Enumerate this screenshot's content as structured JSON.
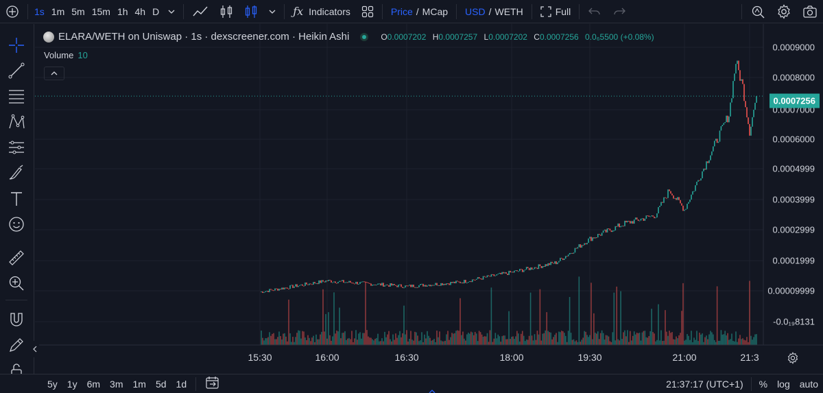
{
  "toolbar": {
    "intervals": [
      "1s",
      "1m",
      "5m",
      "15m",
      "1h",
      "4h",
      "D"
    ],
    "indicators_label": "Indicators",
    "price_label": "Price",
    "mcap_label": "MCap",
    "currency_usd": "USD",
    "currency_weth": "WETH",
    "separator": "/",
    "fullscreen_label": "Full"
  },
  "legend": {
    "title": "ELARA/WETH on Uniswap · 1s · dexscreener.com · Heikin Ashi",
    "open_key": "O",
    "open": "0.0007202",
    "high_key": "H",
    "high": "0.0007257",
    "low_key": "L",
    "low": "0.0007202",
    "close_key": "C",
    "close": "0.0007256",
    "change": "0.0₆5500 (+0.08%)",
    "volume_label": "Volume",
    "volume_value": "10"
  },
  "price_axis": {
    "ticks": [
      "0.0009000",
      "0.0008000",
      "0.0007000",
      "0.0006000",
      "0.0004999",
      "0.0003999",
      "0.0002999",
      "0.0001999",
      "0.00009999",
      "-0.0₁₉8131"
    ],
    "last_price": "0.0007256"
  },
  "time_axis": {
    "ticks": [
      "15:30",
      "16:00",
      "16:30",
      "18:00",
      "19:30",
      "21:00",
      "21:3"
    ]
  },
  "bottom": {
    "ranges": [
      "5y",
      "1y",
      "6m",
      "3m",
      "1m",
      "5d",
      "1d"
    ],
    "clock": "21:37:17 (UTC+1)",
    "percent_label": "%",
    "log_label": "log",
    "auto_label": "auto"
  },
  "colors": {
    "up": "#26a69a",
    "down": "#ef5350",
    "accent": "#2962ff",
    "background": "#131722"
  },
  "chart_data": {
    "type": "line",
    "style": "Heikin Ashi candles",
    "x": [
      "15:30",
      "16:00",
      "16:30",
      "17:15",
      "18:00",
      "18:45",
      "19:30",
      "20:00",
      "20:30",
      "20:45",
      "21:00",
      "21:10",
      "21:20",
      "21:25",
      "21:30",
      "21:35",
      "21:37"
    ],
    "series": [
      {
        "values": [
          2.5e-05,
          6.5e-05,
          4.5e-05,
          6e-05,
          9.5e-05,
          0.00013,
          0.000215,
          0.00027,
          0.0003,
          0.00039,
          0.00032,
          0.00052,
          0.00066,
          0.00085,
          0.00076,
          0.0006,
          0.0007256
        ]
      }
    ],
    "ylim": [
      -8.13e-05,
      0.00095
    ],
    "volume": "bars below price, colored by candle direction"
  }
}
